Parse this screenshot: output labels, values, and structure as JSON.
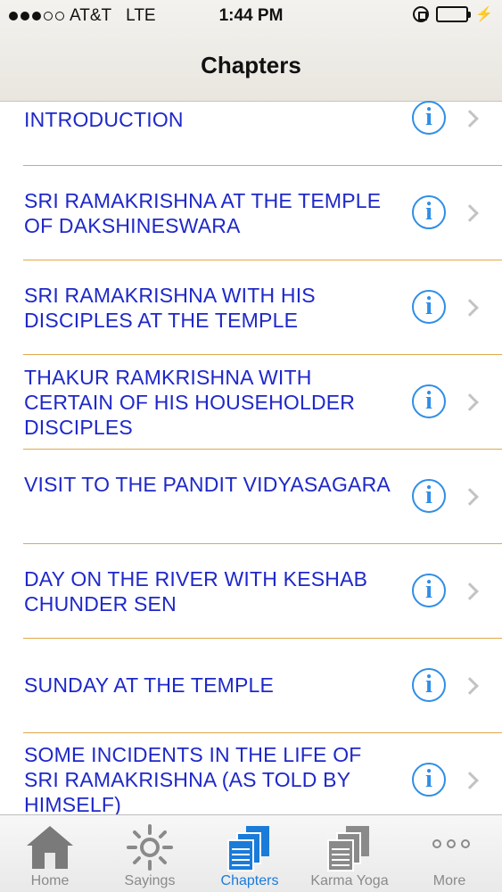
{
  "status": {
    "carrier": "AT&T",
    "network": "LTE",
    "time": "1:44 PM"
  },
  "nav": {
    "title": "Chapters"
  },
  "chapters": [
    "INTRODUCTION",
    "SRI RAMAKRISHNA AT THE TEMPLE OF DAKSHINESWARA",
    "SRI RAMAKRISHNA WITH HIS DISCIPLES AT THE TEMPLE",
    "THAKUR RAMKRISHNA WITH CERTAIN OF HIS HOUSEHOLDER DISCIPLES",
    "VISIT TO THE PANDIT VIDYASAGARA",
    "DAY ON THE RIVER WITH KESHAB CHUNDER SEN",
    "SUNDAY AT THE TEMPLE",
    "SOME INCIDENTS IN THE LIFE OF SRI RAMAKRISHNA (AS TOLD BY HIMSELF)"
  ],
  "tabs": {
    "home": "Home",
    "sayings": "Sayings",
    "chapters": "Chapters",
    "karma_yoga": "Karma Yoga",
    "more": "More"
  },
  "colors": {
    "link": "#1e28c9",
    "accent": "#1a7bd9",
    "separator": "#e1a84a",
    "info": "#2f8ee6"
  },
  "icons": [
    "info-icon",
    "chevron-right-icon",
    "home-icon",
    "sun-icon",
    "document-stack-icon",
    "more-dots-icon",
    "lock-rotation-icon",
    "battery-icon"
  ]
}
